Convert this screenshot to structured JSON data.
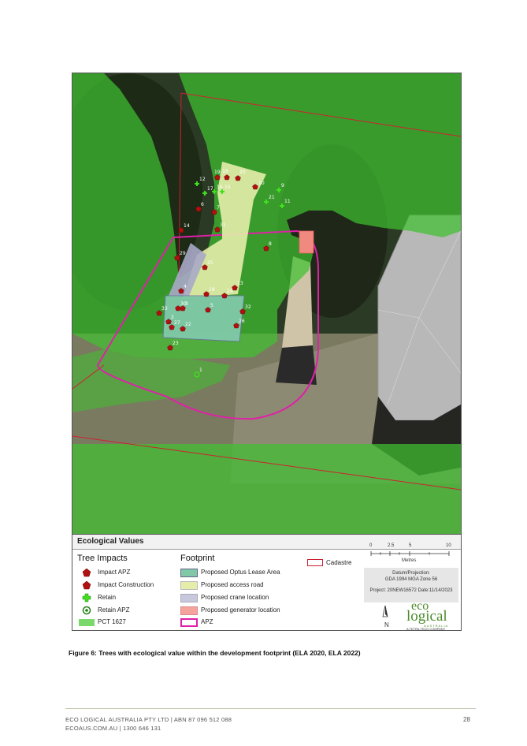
{
  "legend": {
    "title": "Ecological Values",
    "tree_impacts_title": "Tree Impacts",
    "footprint_title": "Footprint",
    "tree_items": [
      "Impact APZ",
      "Impact Construction",
      "Retain",
      "Retain APZ",
      "PCT 1627"
    ],
    "footprint_items": [
      "Proposed Optus Lease Area",
      "Proposed access road",
      "Proposed crane location",
      "Proposed generator location",
      "APZ"
    ],
    "cadastre": "Cadastre",
    "colors": {
      "pct": "#3fbf2a",
      "lease_area": "#80c8a8",
      "access_road": "#e6edaa",
      "crane": "#a8a8c8",
      "generator": "#f08a80",
      "apz": "#e020a8",
      "cadastre": "#d02030",
      "impact": "#b01010",
      "retain": "#40e020"
    }
  },
  "scale": {
    "ticks": [
      "0",
      "2.5",
      "5",
      "10"
    ],
    "units": "Metres"
  },
  "datum": {
    "line1": "Datum/Projection:",
    "line2": "GDA 1994 MGA Zone 56"
  },
  "project": "Project: 20NEW16572 Date:11/14/2023",
  "north": "N",
  "logo": {
    "eco": "eco",
    "logical": "logical",
    "australia": "AUSTRALIA",
    "tagline": "A TETRA TECH COMPANY"
  },
  "tree_labels": [
    "19",
    "18",
    "20",
    "10",
    "17",
    "16",
    "15",
    "9",
    "21",
    "11",
    "12",
    "8",
    "7",
    "14",
    "31",
    "6",
    "29",
    "25",
    "4",
    "30",
    "3",
    "1",
    "24",
    "32",
    "33",
    "2",
    "27",
    "22",
    "26",
    "23",
    "13",
    "28",
    "5"
  ],
  "caption": "Figure 6: Trees with ecological value within the development footprint (ELA 2020, ELA 2022)",
  "footer": {
    "company": "ECO LOGICAL AUSTRALIA PTY LTD | ABN 87 096 512 088",
    "contact": "ECOAUS.COM.AU | 1300 646 131",
    "page": "28"
  }
}
